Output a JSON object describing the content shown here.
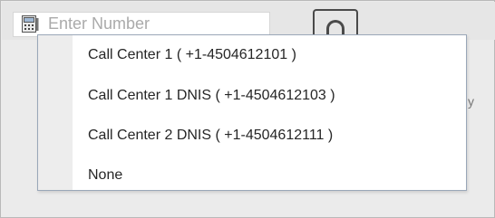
{
  "number_field": {
    "placeholder": "Enter Number",
    "icon": "phone-book-icon"
  },
  "dial_button": {
    "icon": "handset-icon"
  },
  "background_fragment": "y",
  "dropdown": {
    "options": [
      {
        "label": "Call Center 1 ( +1-4504612101 )"
      },
      {
        "label": "Call Center 1 DNIS ( +1-4504612103 )"
      },
      {
        "label": "Call Center 2 DNIS ( +1-4504612111 )"
      },
      {
        "label": "None"
      }
    ]
  },
  "colors": {
    "dropdown_border": "#9aa7b8",
    "gutter": "#ededed",
    "background": "#ebebeb"
  }
}
